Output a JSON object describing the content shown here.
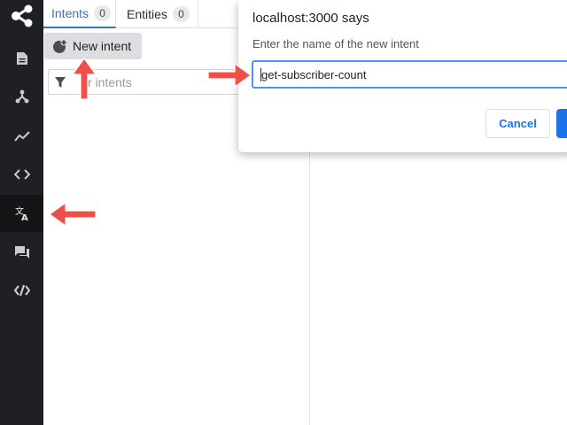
{
  "sidebar": {
    "items": [
      {
        "icon": "share-logo-icon"
      },
      {
        "icon": "document-icon"
      },
      {
        "icon": "hierarchy-icon"
      },
      {
        "icon": "trend-icon"
      },
      {
        "icon": "code-icon"
      },
      {
        "icon": "translate-icon"
      },
      {
        "icon": "chat-icon"
      },
      {
        "icon": "api-icon"
      }
    ],
    "active_index": 5,
    "accent": "#3b8ad9"
  },
  "tabs": [
    {
      "label": "Intents",
      "count": "0"
    },
    {
      "label": "Entities",
      "count": "0"
    }
  ],
  "toolbar": {
    "new_intent_label": "New intent"
  },
  "filter": {
    "placeholder": "Filter intents",
    "visible_text": "r intents"
  },
  "dialog": {
    "title": "localhost:3000 says",
    "message": "Enter the name of the new intent",
    "input_value": "get-subscriber-count",
    "cancel_label": "Cancel",
    "ok_color": "#1a73e8"
  },
  "annotations": {
    "arrow_color": "#ef4f47"
  }
}
